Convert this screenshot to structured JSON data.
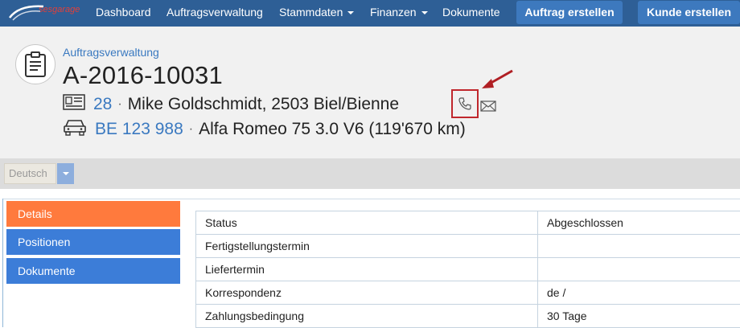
{
  "nav": {
    "logo_text": "sesgarage",
    "items": [
      {
        "label": "Dashboard",
        "dropdown": false
      },
      {
        "label": "Auftragsverwaltung",
        "dropdown": false
      },
      {
        "label": "Stammdaten",
        "dropdown": true
      },
      {
        "label": "Finanzen",
        "dropdown": true
      },
      {
        "label": "Dokumente",
        "dropdown": false
      }
    ],
    "create_order": "Auftrag erstellen",
    "create_customer": "Kunde erstellen"
  },
  "header": {
    "breadcrumb": "Auftragsverwaltung",
    "title": "A-2016-10031",
    "customer_no": "28",
    "customer_text": "Mike Goldschmidt, 2503 Biel/Bienne",
    "plate": "BE 123 988",
    "vehicle_text": "Alfa Romeo 75 3.0 V6 (119'670 km)",
    "separator": "·"
  },
  "language": {
    "selected": "Deutsch"
  },
  "sidebar": {
    "items": [
      {
        "label": "Details",
        "active": true
      },
      {
        "label": "Positionen",
        "active": false
      },
      {
        "label": "Dokumente",
        "active": false
      }
    ]
  },
  "details": {
    "rows": [
      {
        "label": "Status",
        "value": "Abgeschlossen"
      },
      {
        "label": "Fertigstellungstermin",
        "value": ""
      },
      {
        "label": "Liefertermin",
        "value": ""
      },
      {
        "label": "Korrespondenz",
        "value": "de /"
      },
      {
        "label": "Zahlungsbedingung",
        "value": "30 Tage"
      }
    ]
  },
  "colors": {
    "navbar": "#2e5f96",
    "nav_button": "#3d79be",
    "active_tab": "#ff7a3d",
    "tab": "#3c7dd8",
    "link": "#3a79c0",
    "highlight": "#c0272d"
  }
}
